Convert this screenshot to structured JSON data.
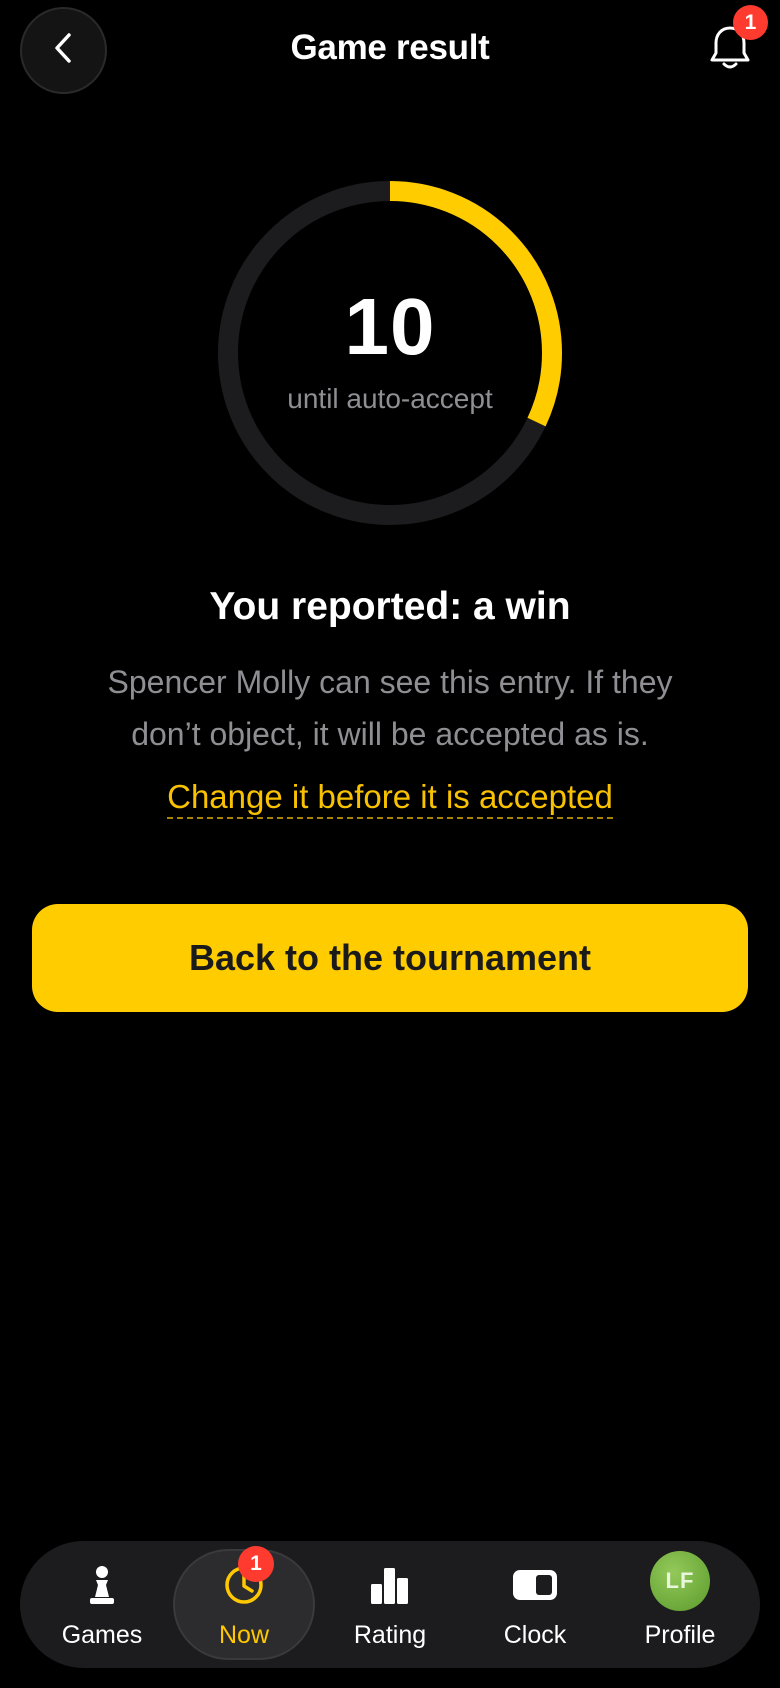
{
  "header": {
    "title": "Game result",
    "back_icon": "chevron-left-icon",
    "notification_icon": "bell-icon",
    "notification_count": "1"
  },
  "timer": {
    "value": "10",
    "caption": "until auto-accept",
    "progress_fraction": 0.32,
    "accent_color": "#ffcc00",
    "track_color": "#1c1c1e"
  },
  "result": {
    "heading": "You reported: a win",
    "description": "Spencer Molly can see this entry. If they don’t object, it will be accepted as is.",
    "change_link": "Change it before it is accepted"
  },
  "primary_button": {
    "label": "Back to the tournament",
    "color": "#ffcc00"
  },
  "tabbar": {
    "active": "Now",
    "now_badge": "1",
    "tabs": [
      {
        "label": "Games",
        "icon": "pawn-icon"
      },
      {
        "label": "Now",
        "icon": "clock-icon"
      },
      {
        "label": "Rating",
        "icon": "bar-chart-icon"
      },
      {
        "label": "Clock",
        "icon": "chess-clock-icon"
      },
      {
        "label": "Profile",
        "icon": "avatar",
        "initials": "LF"
      }
    ]
  }
}
